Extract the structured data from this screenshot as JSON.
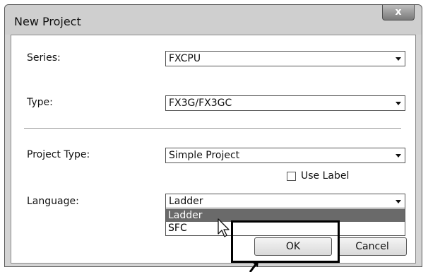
{
  "dialog": {
    "title": "New Project",
    "close_glyph": "x"
  },
  "form": {
    "series": {
      "label": "Series:",
      "value": "FXCPU"
    },
    "type": {
      "label": "Type:",
      "value": "FX3G/FX3GC"
    },
    "project_type": {
      "label": "Project Type:",
      "value": "Simple Project"
    },
    "use_label": {
      "label": "Use Label",
      "checked": false
    },
    "language": {
      "label": "Language:",
      "value": "Ladder",
      "options": [
        "Ladder",
        "SFC"
      ],
      "highlighted_option": "Ladder"
    }
  },
  "buttons": {
    "ok": "OK",
    "cancel": "Cancel"
  },
  "icons": {
    "dropdown": "chevron-down-icon",
    "close": "close-icon",
    "cursor": "mouse-pointer-icon",
    "callout": "arrow-pointer-icon"
  },
  "colors": {
    "highlight": "#6a6a6a",
    "annotation": "#000000"
  }
}
